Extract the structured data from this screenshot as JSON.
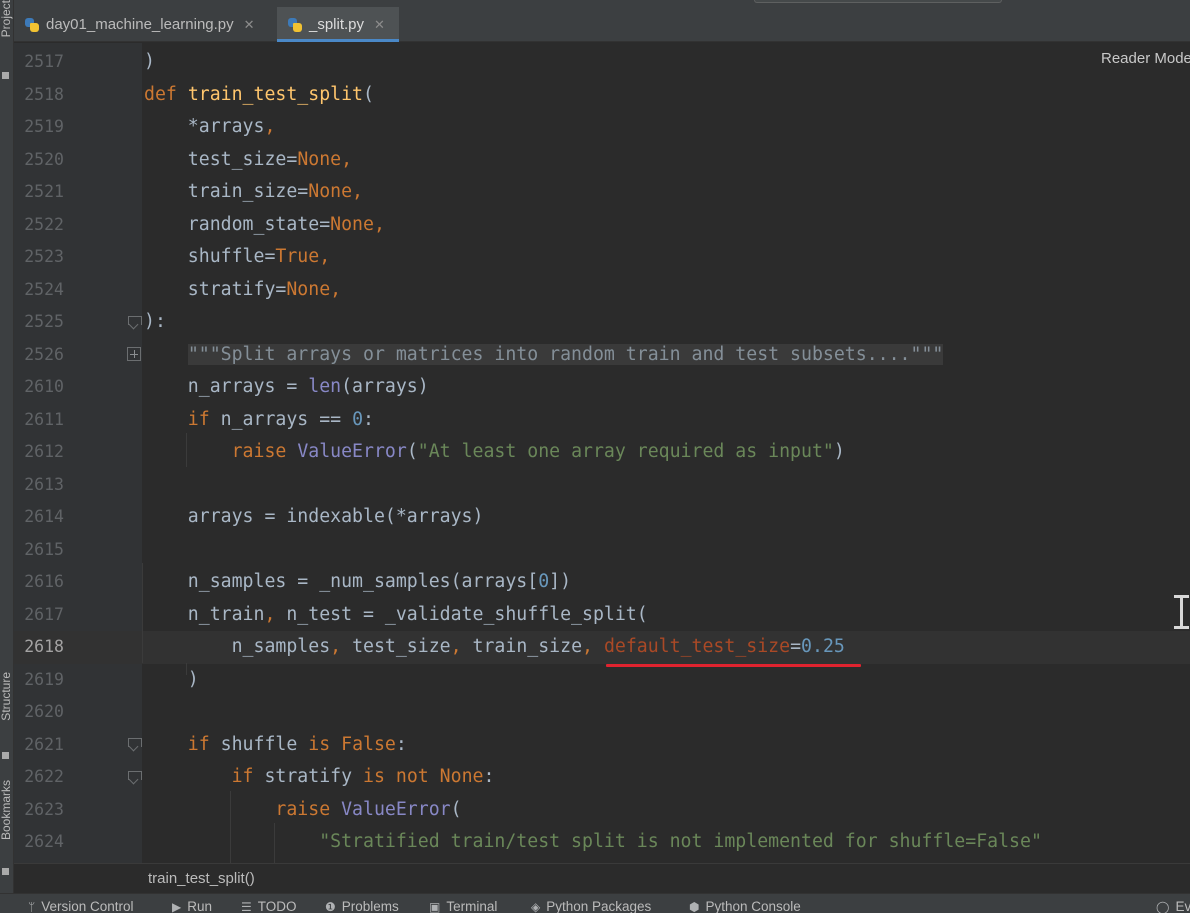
{
  "sidebar": {
    "project_label": "Project",
    "structure_label": "Structure",
    "bookmarks_label": "Bookmarks"
  },
  "tabs": [
    {
      "label": "day01_machine_learning.py",
      "active": false
    },
    {
      "label": "_split.py",
      "active": true
    }
  ],
  "editor": {
    "reader_mode_label": "Reader Mode",
    "current_line": "2618",
    "lines": [
      {
        "num": "2517",
        "tokens": [
          [
            "",
            ")"
          ]
        ]
      },
      {
        "num": "2518",
        "tokens": [
          [
            "kw",
            "def "
          ],
          [
            "fn",
            "train_test_split"
          ],
          [
            "",
            "("
          ]
        ]
      },
      {
        "num": "2519",
        "tokens": [
          [
            "",
            "    *arrays"
          ],
          [
            "kw",
            ","
          ]
        ]
      },
      {
        "num": "2520",
        "tokens": [
          [
            "",
            "    test_size="
          ],
          [
            "kw",
            "None,"
          ]
        ]
      },
      {
        "num": "2521",
        "tokens": [
          [
            "",
            "    train_size="
          ],
          [
            "kw",
            "None,"
          ]
        ]
      },
      {
        "num": "2522",
        "tokens": [
          [
            "",
            "    random_state="
          ],
          [
            "kw",
            "None,"
          ]
        ]
      },
      {
        "num": "2523",
        "tokens": [
          [
            "",
            "    shuffle="
          ],
          [
            "kw",
            "True,"
          ]
        ]
      },
      {
        "num": "2524",
        "tokens": [
          [
            "",
            "    stratify="
          ],
          [
            "kw",
            "None,"
          ]
        ]
      },
      {
        "num": "2525",
        "tokens": [
          [
            "",
            "):"
          ]
        ]
      },
      {
        "num": "2526",
        "tokens": [
          [
            "",
            "    "
          ],
          [
            "doc",
            "\"\"\"Split arrays or matrices into random train and test subsets....\"\"\""
          ]
        ]
      },
      {
        "num": "2610",
        "tokens": [
          [
            "",
            "    n_arrays = "
          ],
          [
            "bi",
            "len"
          ],
          [
            "",
            "(arrays)"
          ]
        ]
      },
      {
        "num": "2611",
        "tokens": [
          [
            "kw",
            "    if "
          ],
          [
            "",
            "n_arrays == "
          ],
          [
            "num",
            "0"
          ],
          [
            "",
            ":"
          ]
        ]
      },
      {
        "num": "2612",
        "tokens": [
          [
            "kw",
            "        raise "
          ],
          [
            "bi",
            "ValueError"
          ],
          [
            "",
            "("
          ],
          [
            "str",
            "\"At least one array required as input\""
          ],
          [
            "",
            ")"
          ]
        ]
      },
      {
        "num": "2613",
        "tokens": []
      },
      {
        "num": "2614",
        "tokens": [
          [
            "",
            "    arrays = indexable(*arrays)"
          ]
        ]
      },
      {
        "num": "2615",
        "tokens": []
      },
      {
        "num": "2616",
        "tokens": [
          [
            "",
            "    n_samples = _num_samples(arrays["
          ],
          [
            "num",
            "0"
          ],
          [
            "",
            "])"
          ]
        ]
      },
      {
        "num": "2617",
        "tokens": [
          [
            "",
            "    n_train"
          ],
          [
            "kw",
            ", "
          ],
          [
            "",
            "n_test = _validate_shuffle_split("
          ]
        ]
      },
      {
        "num": "2618",
        "tokens": [
          [
            "",
            "        n_samples"
          ],
          [
            "kw",
            ", "
          ],
          [
            "",
            "test_size"
          ],
          [
            "kw",
            ", "
          ],
          [
            "",
            "train_size"
          ],
          [
            "kw",
            ", "
          ],
          [
            "par",
            "default_test_size"
          ],
          [
            "",
            "="
          ],
          [
            "num",
            "0.25"
          ]
        ]
      },
      {
        "num": "2619",
        "tokens": [
          [
            "",
            "    )"
          ]
        ]
      },
      {
        "num": "2620",
        "tokens": []
      },
      {
        "num": "2621",
        "tokens": [
          [
            "kw",
            "    if "
          ],
          [
            "",
            "shuffle "
          ],
          [
            "kw",
            "is False"
          ],
          [
            "",
            ":"
          ]
        ]
      },
      {
        "num": "2622",
        "tokens": [
          [
            "kw",
            "        if "
          ],
          [
            "",
            "stratify "
          ],
          [
            "kw",
            "is not None"
          ],
          [
            "",
            ":"
          ]
        ]
      },
      {
        "num": "2623",
        "tokens": [
          [
            "kw",
            "            raise "
          ],
          [
            "bi",
            "ValueError"
          ],
          [
            "",
            "("
          ]
        ]
      },
      {
        "num": "2624",
        "tokens": [
          [
            "",
            "                "
          ],
          [
            "str",
            "\"Stratified train/test split is not implemented for shuffle=False\""
          ]
        ]
      }
    ]
  },
  "breadcrumb": {
    "label": "train_test_split()"
  },
  "toolbar": {
    "items": [
      {
        "label": "Version Control",
        "icon": "branch-icon"
      },
      {
        "label": "Run",
        "icon": "play-icon"
      },
      {
        "label": "TODO",
        "icon": "list-icon"
      },
      {
        "label": "Problems",
        "icon": "alert-icon"
      },
      {
        "label": "Terminal",
        "icon": "terminal-icon"
      },
      {
        "label": "Python Packages",
        "icon": "packages-icon"
      },
      {
        "label": "Python Console",
        "icon": "python-icon"
      },
      {
        "label": "Ev",
        "icon": "event-log-icon"
      }
    ]
  },
  "colors": {
    "background": "#2b2b2b",
    "keyword": "#cc7832",
    "function": "#ffc66d",
    "number": "#6897bb",
    "string": "#6a8759",
    "builtin": "#8888c6",
    "parameter": "#aa4926",
    "annotation_underline": "#e0232f",
    "active_tab_indicator": "#4a88c7"
  }
}
